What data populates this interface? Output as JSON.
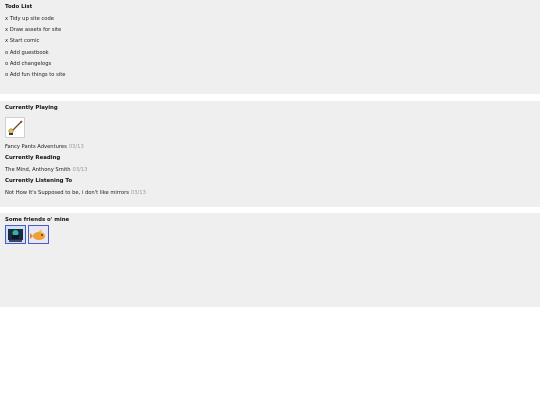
{
  "todo": {
    "heading": "Todo List",
    "items": [
      "x Tidy up site code",
      "x Draw assets for site",
      "x Start comic",
      "o Add guestbook",
      "o Add changelogs",
      "o Add fun things to site"
    ]
  },
  "playing": {
    "heading": "Currently Playing",
    "thumbnail_icon": "game-thumbnail-icon",
    "title": "Fancy Pants Adventures",
    "date": "03/13"
  },
  "reading": {
    "heading": "Currently Reading",
    "title": "The Mind, Anthony Smith",
    "date": "03/13"
  },
  "listening": {
    "heading": "Currently Listening To",
    "title": "Not How It's Supposed to be, i don't like mirrors",
    "date": "03/13"
  },
  "friends": {
    "heading": "Some friends o' mine",
    "buttons": [
      {
        "icon": "friend-site-button-icon"
      },
      {
        "icon": "friend-site-button-icon"
      }
    ]
  },
  "colors": {
    "panel_bg": "#efefef",
    "date_text": "#9a9a9a",
    "friend_border": "#4a5cc8"
  }
}
